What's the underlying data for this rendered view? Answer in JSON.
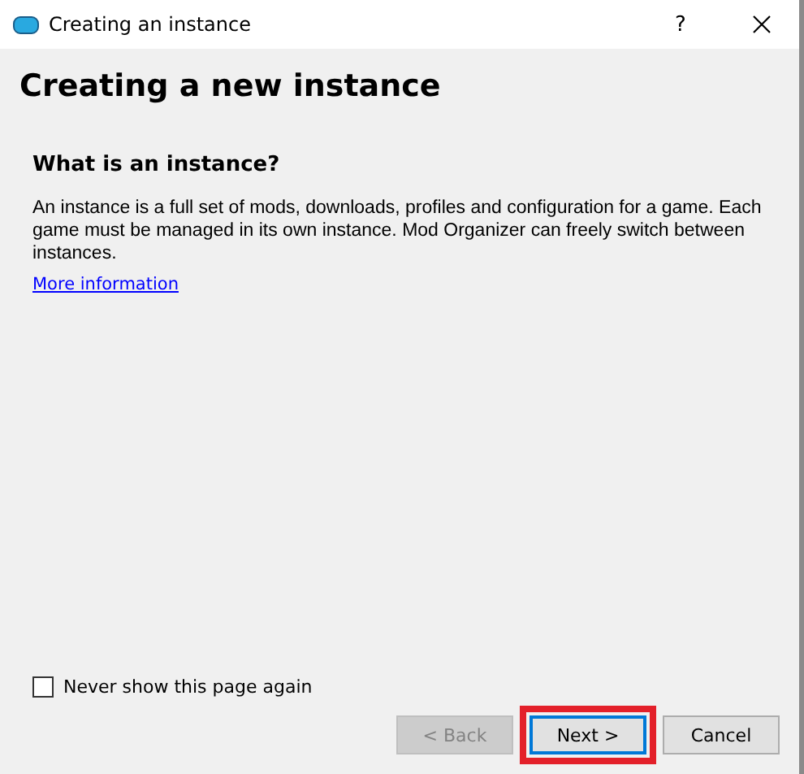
{
  "window": {
    "title": "Creating an instance",
    "help": "?"
  },
  "page": {
    "title": "Creating a new instance",
    "heading": "What is an instance?",
    "description": "An instance is a full set of mods, downloads, profiles and configuration for a game. Each game must be managed in its own instance. Mod Organizer can freely switch between instances.",
    "link": "More information"
  },
  "never_show": {
    "label": "Never show this page again",
    "checked": false
  },
  "buttons": [
    {
      "label": "< Back",
      "disabled": true,
      "focused": false,
      "highlighted": false
    },
    {
      "label": "Next >",
      "disabled": false,
      "focused": true,
      "highlighted": true
    },
    {
      "label": "Cancel",
      "disabled": false,
      "focused": false,
      "highlighted": false
    }
  ]
}
